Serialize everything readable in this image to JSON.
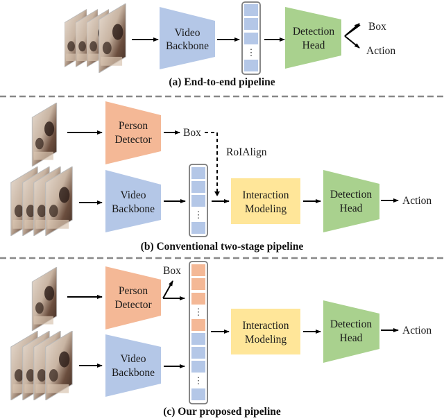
{
  "colors": {
    "video_backbone": "#b4c7e7",
    "person_detector": "#f4b896",
    "interaction": "#ffe699",
    "detection_head": "#a9d18e",
    "separator": "#888888",
    "feature_video": "#b4c7e7",
    "feature_person": "#f4b896"
  },
  "panels": [
    {
      "id": "a",
      "caption": "(a) End-to-end pipeline",
      "inputs": [
        "video-clip"
      ],
      "modules": [
        {
          "name": "Video Backbone",
          "lines": [
            "Video",
            "Backbone"
          ],
          "type": "video_backbone"
        },
        {
          "name": "Detection Head",
          "lines": [
            "Detection",
            "Head"
          ],
          "type": "detection_head"
        }
      ],
      "outputs": [
        "Box",
        "Action"
      ]
    },
    {
      "id": "b",
      "caption": "(b) Conventional two-stage pipeline",
      "inputs": [
        "key-frame",
        "video-clip"
      ],
      "modules": [
        {
          "name": "Person Detector",
          "lines": [
            "Person",
            "Detector"
          ],
          "type": "person_detector"
        },
        {
          "name": "Video Backbone",
          "lines": [
            "Video",
            "Backbone"
          ],
          "type": "video_backbone"
        },
        {
          "name": "Interaction Modeling",
          "lines": [
            "Interaction",
            "Modeling"
          ],
          "type": "interaction"
        },
        {
          "name": "Detection Head",
          "lines": [
            "Detection",
            "Head"
          ],
          "type": "detection_head"
        }
      ],
      "intermediate": "Box",
      "connector": "RoIAlign",
      "outputs": [
        "Action"
      ]
    },
    {
      "id": "c",
      "caption": "(c) Our proposed pipeline",
      "inputs": [
        "key-frame",
        "video-clip"
      ],
      "modules": [
        {
          "name": "Person Detector",
          "lines": [
            "Person",
            "Detector"
          ],
          "type": "person_detector"
        },
        {
          "name": "Video Backbone",
          "lines": [
            "Video",
            "Backbone"
          ],
          "type": "video_backbone"
        },
        {
          "name": "Interaction Modeling",
          "lines": [
            "Interaction",
            "Modeling"
          ],
          "type": "interaction"
        },
        {
          "name": "Detection Head",
          "lines": [
            "Detection",
            "Head"
          ],
          "type": "detection_head"
        }
      ],
      "intermediate": "Box",
      "outputs": [
        "Action"
      ]
    }
  ],
  "ellipsis": "⋮"
}
